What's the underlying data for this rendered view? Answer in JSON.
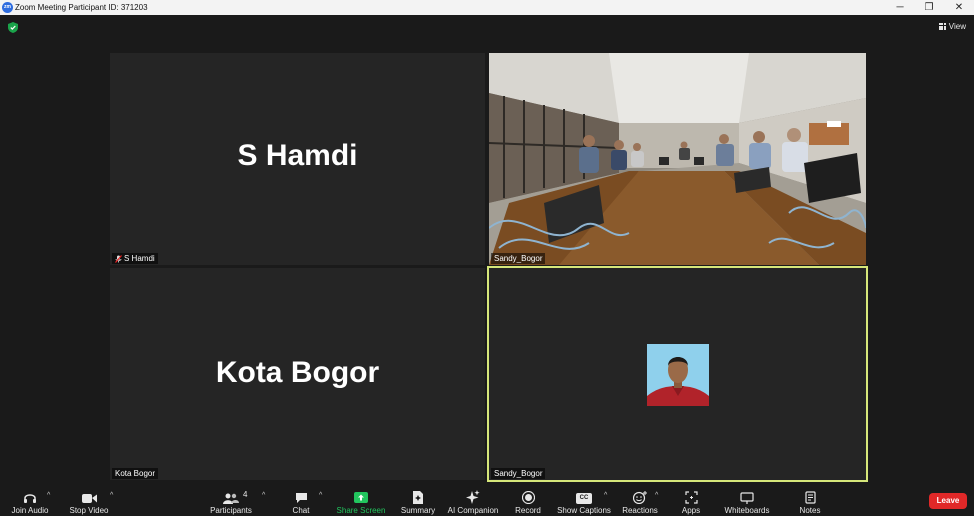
{
  "window": {
    "title": "Zoom Meeting Participant ID: 371203",
    "app_icon_text": "zm",
    "minimize": "─",
    "restore": "❐",
    "close": "✕"
  },
  "header": {
    "view_label": "View"
  },
  "tiles": [
    {
      "big_name": "S Hamdi",
      "tag": "S Hamdi",
      "muted": true
    },
    {
      "big_name": "",
      "tag": "Sandy_Bogor",
      "muted": false,
      "video": "conference-room-camera"
    },
    {
      "big_name": "Kota Bogor",
      "tag": "Kota Bogor",
      "muted": false
    },
    {
      "big_name": "",
      "tag": "Sandy_Bogor",
      "muted": false,
      "video": "profile-photo",
      "active_speaker": true
    }
  ],
  "toolbar": {
    "join_audio": "Join Audio",
    "stop_video": "Stop Video",
    "participants": "Participants",
    "participants_count": "4",
    "chat": "Chat",
    "share_screen": "Share Screen",
    "summary": "Summary",
    "ai_companion": "AI Companion",
    "record": "Record",
    "show_captions": "Show Captions",
    "cc_badge": "CC",
    "reactions": "Reactions",
    "apps": "Apps",
    "whiteboards": "Whiteboards",
    "notes": "Notes",
    "leave": "Leave"
  },
  "colors": {
    "accent_green": "#22c55e",
    "leave_red": "#e02828",
    "active_border": "#d6e77a",
    "shield_green": "#1aa34a"
  }
}
